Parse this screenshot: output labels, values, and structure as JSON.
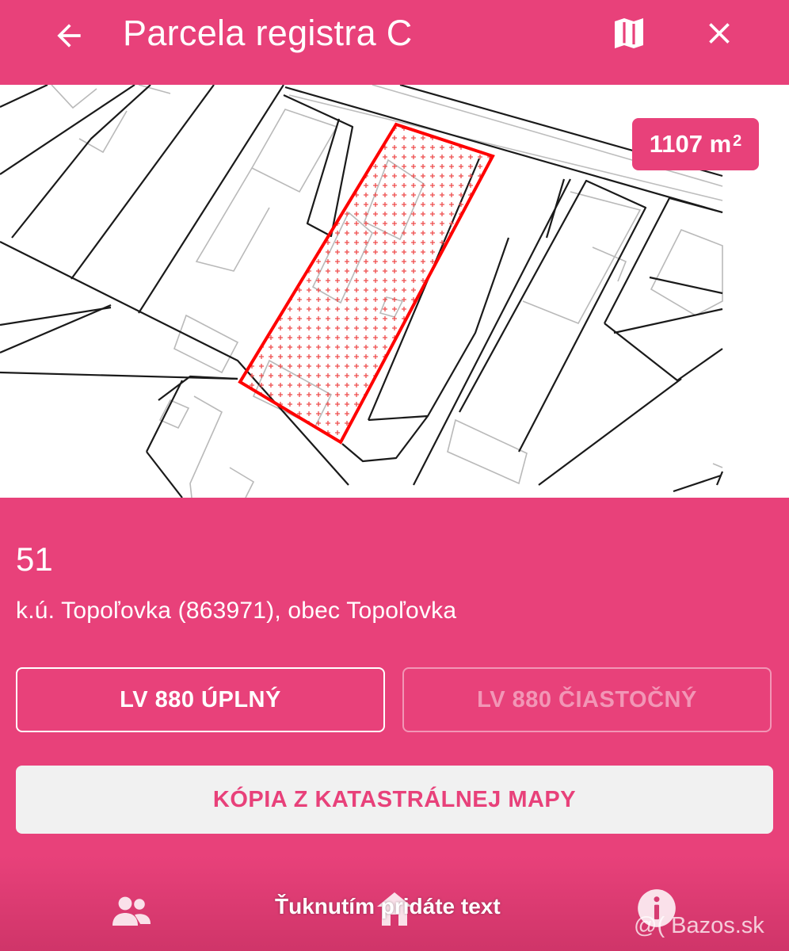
{
  "header": {
    "title": "Parcela registra C",
    "back_icon": "arrow-left-icon",
    "map_icon": "map-icon",
    "close_icon": "close-icon"
  },
  "map": {
    "area_value": "1107 m",
    "area_unit_exp": "2",
    "highlight_color": "#ff0000"
  },
  "parcel": {
    "number": "51",
    "location": "k.ú. Topoľovka (863971), obec Topoľovka"
  },
  "buttons": {
    "lv_full": "LV 880 ÚPLNÝ",
    "lv_partial": "LV 880 ČIASTOČNÝ",
    "map_copy": "KÓPIA Z KATASTRÁLNEJ MAPY"
  },
  "bottom_nav": {
    "items": [
      "people-icon",
      "home-icon",
      "info-icon"
    ]
  },
  "overlay": {
    "caption": "Ťuknutím pridáte text",
    "watermark": "@( Bazos.sk"
  },
  "colors": {
    "accent": "#e8417a",
    "button_light": "#f1f1f1"
  }
}
